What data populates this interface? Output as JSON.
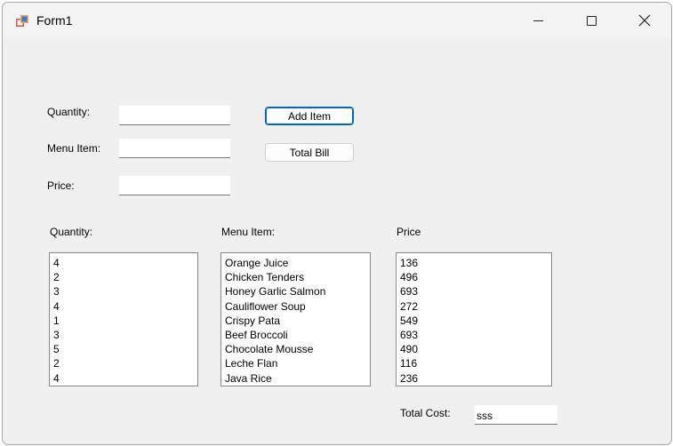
{
  "window": {
    "title": "Form1"
  },
  "inputs": {
    "quantity_label": "Quantity:",
    "quantity_value": "",
    "menu_item_label": "Menu Item:",
    "menu_item_value": "",
    "price_label": "Price:",
    "price_value": ""
  },
  "buttons": {
    "add_item": "Add Item",
    "total_bill": "Total Bill"
  },
  "lists": {
    "quantity": {
      "header": "Quantity:",
      "items": [
        "4",
        "2",
        "3",
        "4",
        "1",
        "3",
        "5",
        "2",
        "4"
      ]
    },
    "menu_item": {
      "header": "Menu Item:",
      "items": [
        "Orange Juice",
        "Chicken Tenders",
        "Honey Garlic Salmon",
        "Cauliflower Soup",
        "Crispy Pata",
        "Beef Broccoli",
        "Chocolate Mousse",
        "Leche Flan",
        "Java Rice"
      ]
    },
    "price": {
      "header": "Price",
      "items": [
        "136",
        "496",
        "693",
        "272",
        "549",
        "693",
        "490",
        "116",
        "236"
      ]
    }
  },
  "total": {
    "label": "Total Cost:",
    "value": "sss"
  }
}
